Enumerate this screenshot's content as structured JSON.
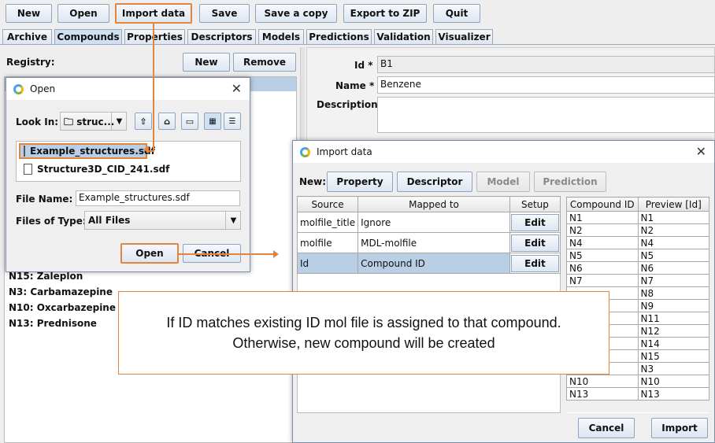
{
  "toolbar": {
    "new_label": "New",
    "open_label": "Open",
    "import_label": "Import data",
    "save_label": "Save",
    "save_copy_label": "Save a copy",
    "export_label": "Export to ZIP",
    "quit_label": "Quit"
  },
  "tabs": [
    "Archive",
    "Compounds",
    "Properties",
    "Descriptors",
    "Models",
    "Predictions",
    "Validation",
    "Visualizer"
  ],
  "registry": {
    "label": "Registry:",
    "new_label": "New",
    "remove_label": "Remove",
    "items": [
      "N15: Zaleplon",
      "N3: Carbamazepine",
      "N10: Oxcarbazepine",
      "N13: Prednisone"
    ]
  },
  "details": {
    "id_label": "Id *",
    "id_value": "B1",
    "name_label": "Name *",
    "name_value": "Benzene",
    "description_label": "Description"
  },
  "open_dialog": {
    "title": "Open",
    "look_in_label": "Look In:",
    "look_in_value": "struc...",
    "files": [
      "Example_structures.sdf",
      "Structure3D_CID_241.sdf"
    ],
    "file_name_label": "File Name:",
    "file_name_value": "Example_structures.sdf",
    "files_of_type_label": "Files of Type:",
    "files_of_type_value": "All Files",
    "open_label": "Open",
    "cancel_label": "Cancel"
  },
  "import_dialog": {
    "title": "Import data",
    "new_label": "New:",
    "property_label": "Property",
    "descriptor_label": "Descriptor",
    "model_label": "Model",
    "prediction_label": "Prediction",
    "mapping_headers": [
      "Source",
      "Mapped to",
      "Setup"
    ],
    "mapping_rows": [
      {
        "source": "molfile_title",
        "mapped": "Ignore",
        "setup": "Edit"
      },
      {
        "source": "molfile",
        "mapped": "MDL-molfile",
        "setup": "Edit"
      },
      {
        "source": "Id",
        "mapped": "Compound ID",
        "setup": "Edit"
      }
    ],
    "preview_headers": [
      "Compound ID",
      "Preview [Id]"
    ],
    "preview_rows": [
      [
        "N1",
        "N1"
      ],
      [
        "N2",
        "N2"
      ],
      [
        "N4",
        "N4"
      ],
      [
        "N5",
        "N5"
      ],
      [
        "N6",
        "N6"
      ],
      [
        "N7",
        "N7"
      ],
      [
        "",
        "N8"
      ],
      [
        "",
        "N9"
      ],
      [
        "",
        "N11"
      ],
      [
        "",
        "N12"
      ],
      [
        "",
        "N14"
      ],
      [
        "",
        "N15"
      ],
      [
        "",
        "N3"
      ],
      [
        "N10",
        "N10"
      ],
      [
        "N13",
        "N13"
      ]
    ],
    "cancel_label": "Cancel",
    "import_label": "Import"
  },
  "note": {
    "line1": "If ID matches existing ID mol file is assigned to that compound.",
    "line2": "Otherwise, new compound will be created"
  },
  "colors": {
    "accent_orange": "#e2853f",
    "selection": "#b8cfe5",
    "tab_active": "#cfe0f3"
  }
}
